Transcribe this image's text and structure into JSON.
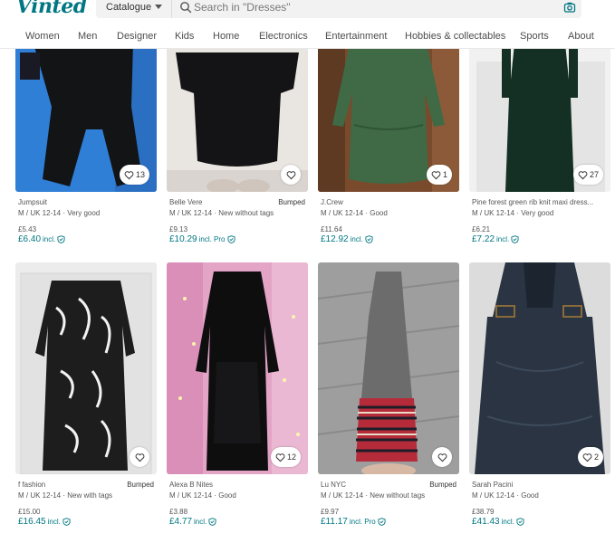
{
  "app": {
    "logo": "Vinted"
  },
  "search": {
    "catalogue_label": "Catalogue",
    "placeholder": "Search in \"Dresses\""
  },
  "nav": {
    "items": [
      "Women",
      "Men",
      "Designer",
      "Kids",
      "Home",
      "Electronics",
      "Entertainment",
      "Hobbies & collectables",
      "Sports",
      "About"
    ]
  },
  "colors": {
    "accent": "#007782",
    "text_muted": "#555555"
  },
  "listings": [
    {
      "brand": "Jumpsuit",
      "bumped": "",
      "details": "M / UK 12-14 · Very good",
      "price": "£5.43",
      "incl_price": "£6.40",
      "incl_label": "incl.",
      "favorites": "13"
    },
    {
      "brand": "Belle Vere",
      "bumped": "Bumped",
      "details": "M / UK 12-14 · New without tags",
      "price": "£9.13",
      "incl_price": "£10.29",
      "incl_label": "incl. Pro",
      "favorites": ""
    },
    {
      "brand": "J.Crew",
      "bumped": "",
      "details": "M / UK 12-14 · Good",
      "price": "£11.64",
      "incl_price": "£12.92",
      "incl_label": "incl.",
      "favorites": "1"
    },
    {
      "brand": "Pine forest green rib knit maxi dress...",
      "bumped": "",
      "details": "M / UK 12-14 · Very good",
      "price": "£6.21",
      "incl_price": "£7.22",
      "incl_label": "incl.",
      "favorites": "27"
    },
    {
      "brand": "f fashion",
      "bumped": "Bumped",
      "details": "M / UK 12-14 · New with tags",
      "price": "£15.00",
      "incl_price": "£16.45",
      "incl_label": "incl.",
      "favorites": ""
    },
    {
      "brand": "Alexa B Nites",
      "bumped": "",
      "details": "M / UK 12-14 · Good",
      "price": "£3.88",
      "incl_price": "£4.77",
      "incl_label": "incl.",
      "favorites": "12"
    },
    {
      "brand": "Lu NYC",
      "bumped": "Bumped",
      "details": "M / UK 12-14 · New without tags",
      "price": "£9.97",
      "incl_price": "£11.17",
      "incl_label": "incl. Pro",
      "favorites": ""
    },
    {
      "brand": "Sarah Pacini",
      "bumped": "",
      "details": "M / UK 12-14 · Good",
      "price": "£38.79",
      "incl_price": "£41.43",
      "incl_label": "incl.",
      "favorites": "2"
    }
  ]
}
